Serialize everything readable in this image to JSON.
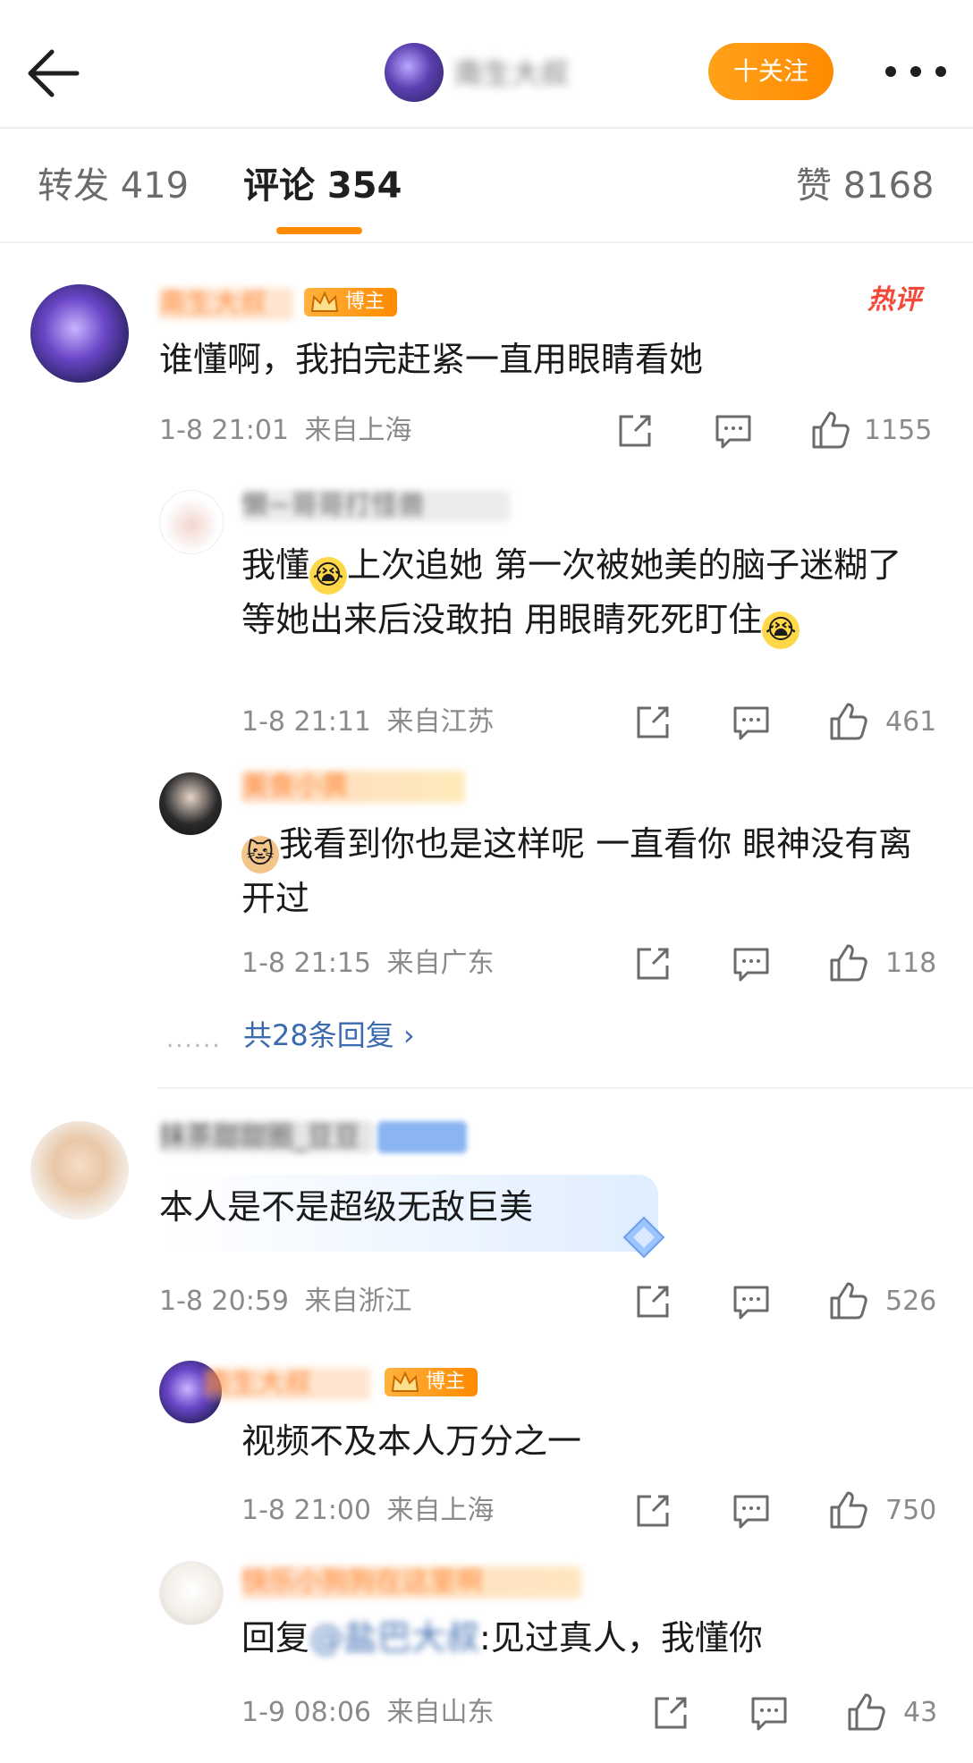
{
  "header": {
    "author_name": "南生大叔",
    "follow_label": "十关注"
  },
  "tabs": [
    {
      "label": "转发 419"
    },
    {
      "label": "评论 354"
    },
    {
      "label": "赞 8168"
    }
  ],
  "hot_label": "热评",
  "author_badge": "博主",
  "comments": [
    {
      "name": "南生大叔",
      "text": "谁懂啊，我拍完赶紧一直用眼睛看她",
      "time": "1-8 21:01",
      "location": "来自上海",
      "likes": "1155",
      "replies": [
        {
          "name": "懒~哥哥打怪兽",
          "text_a": "我懂",
          "text_b": "上次追她 第一次被她美的脑子迷糊了 等她出来后没敢拍 用眼睛死死盯住",
          "time": "1-8 21:11",
          "location": "来自江苏",
          "likes": "461"
        },
        {
          "name": "美食小黄",
          "text": "我看到你也是这样呢 一直看你 眼神没有离开过",
          "time": "1-8 21:15",
          "location": "来自广东",
          "likes": "118"
        }
      ],
      "more_replies": "共28条回复 ›"
    },
    {
      "name": "抹茶甜甜圈_豆豆",
      "text": "本人是不是超级无敌巨美",
      "time": "1-8 20:59",
      "location": "来自浙江",
      "likes": "526",
      "replies": [
        {
          "name": "南生大叔",
          "text": "视频不及本人万分之一",
          "time": "1-8 21:00",
          "location": "来自上海",
          "likes": "750"
        },
        {
          "name": "快乐小狗狗在这里啊",
          "reply_prefix": "回复",
          "mention": "@盐巴大叔",
          "text": ":见过真人，我懂你",
          "time": "1-9 08:06",
          "location": "来自山东",
          "likes": "43"
        }
      ]
    }
  ]
}
